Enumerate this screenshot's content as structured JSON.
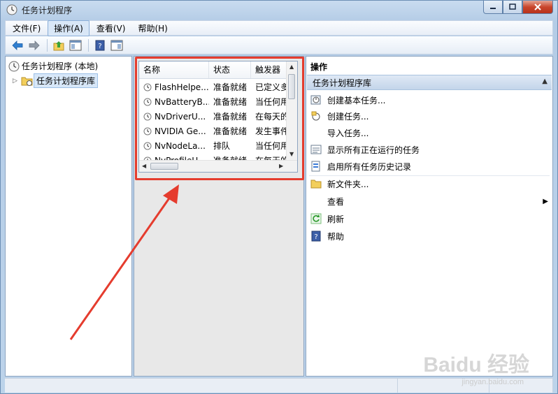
{
  "window": {
    "title": "任务计划程序"
  },
  "menubar": {
    "items": [
      "文件(F)",
      "操作(A)",
      "查看(V)",
      "帮助(H)"
    ]
  },
  "tree": {
    "root": "任务计划程序 (本地)",
    "child": "任务计划程序库"
  },
  "table": {
    "columns": [
      "名称",
      "状态",
      "触发器"
    ],
    "rows": [
      {
        "name": "FlashHelpe...",
        "status": "准备就绪",
        "trigger": "已定义多"
      },
      {
        "name": "NvBatteryB...",
        "status": "准备就绪",
        "trigger": "当任何用"
      },
      {
        "name": "NvDriverU...",
        "status": "准备就绪",
        "trigger": "在每天的"
      },
      {
        "name": "NVIDIA Ge...",
        "status": "准备就绪",
        "trigger": "发生事件"
      },
      {
        "name": "NvNodeLa...",
        "status": "排队",
        "trigger": "当任何用"
      },
      {
        "name": "NvProfileU...",
        "status": "准备就绪",
        "trigger": "在每天的"
      }
    ]
  },
  "actions": {
    "header": "操作",
    "section": "任务计划程序库",
    "items": [
      {
        "label": "创建基本任务...",
        "icon": "create-basic-task-icon"
      },
      {
        "label": "创建任务...",
        "icon": "create-task-icon"
      },
      {
        "label": "导入任务...",
        "icon": ""
      },
      {
        "label": "显示所有正在运行的任务",
        "icon": "running-tasks-icon"
      },
      {
        "label": "启用所有任务历史记录",
        "icon": "history-icon"
      },
      {
        "label": "新文件夹...",
        "icon": "folder-icon"
      },
      {
        "label": "查看",
        "icon": ""
      },
      {
        "label": "刷新",
        "icon": "refresh-icon"
      },
      {
        "label": "帮助",
        "icon": "help-icon"
      }
    ]
  },
  "colors": {
    "annotation": "#e53c2e",
    "accent": "#3b7ad6"
  }
}
